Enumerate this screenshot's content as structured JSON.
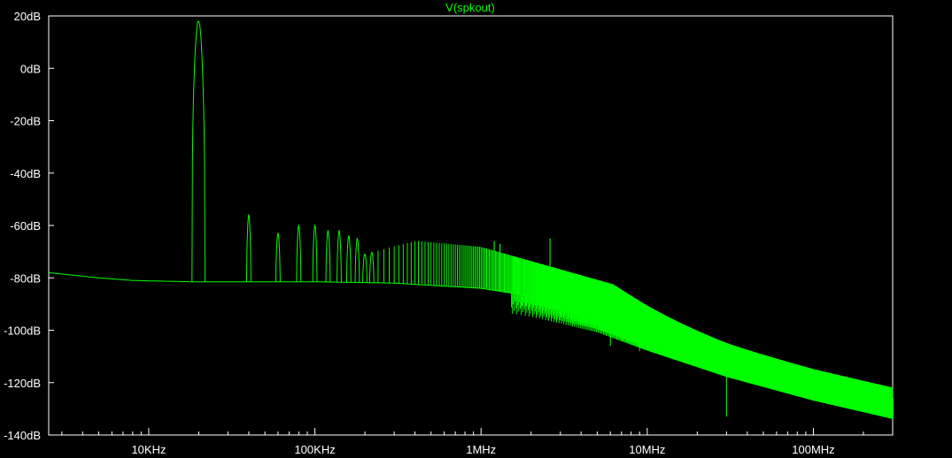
{
  "chart_data": {
    "type": "line",
    "title": "V(spkout)",
    "xlabel": "",
    "ylabel": "",
    "x_scale": "log",
    "xlim": [
      2500,
      300000000
    ],
    "ylim": [
      -140,
      20
    ],
    "y_ticks": [
      20,
      0,
      -20,
      -40,
      -60,
      -80,
      -100,
      -120,
      -140
    ],
    "y_tick_labels": [
      "20dB",
      "0dB",
      "-20dB",
      "-40dB",
      "-60dB",
      "-80dB",
      "-100dB",
      "-120dB",
      "-140dB"
    ],
    "x_ticks": [
      10000,
      100000,
      1000000,
      10000000,
      100000000
    ],
    "x_tick_labels": [
      "10KHz",
      "100KHz",
      "1MHz",
      "10MHz",
      "100MHz"
    ],
    "grid": false,
    "colors": {
      "trace": "#00ff00",
      "background": "#000000",
      "frame": "#ffffff",
      "text": "#ffffff"
    },
    "series": [
      {
        "name": "V(spkout)",
        "fundamental_hz": 20000,
        "baseline": [
          [
            2500,
            -78
          ],
          [
            5000,
            -80
          ],
          [
            8000,
            -81
          ],
          [
            18000,
            -81.5
          ],
          [
            100000,
            -81.5
          ],
          [
            300000,
            -82
          ],
          [
            1000000,
            -84
          ],
          [
            2000000,
            -87
          ],
          [
            5000000,
            -93
          ],
          [
            10000000,
            -100
          ],
          [
            30000000,
            -110
          ],
          [
            100000000,
            -119
          ],
          [
            300000000,
            -126
          ]
        ],
        "peaks": [
          [
            20000,
            18
          ],
          [
            40000,
            -56
          ],
          [
            60000,
            -63
          ],
          [
            80000,
            -60
          ],
          [
            100000,
            -60
          ],
          [
            120000,
            -62
          ],
          [
            140000,
            -62
          ],
          [
            160000,
            -64
          ],
          [
            180000,
            -65
          ],
          [
            1200000,
            -66
          ],
          [
            1300000,
            -67
          ],
          [
            2600000,
            -65
          ]
        ],
        "dips": [
          [
            3000000,
            -95
          ],
          [
            6000000,
            -106
          ],
          [
            9000000,
            -108
          ],
          [
            12000000,
            -109
          ],
          [
            30000000,
            -133
          ]
        ]
      }
    ]
  }
}
